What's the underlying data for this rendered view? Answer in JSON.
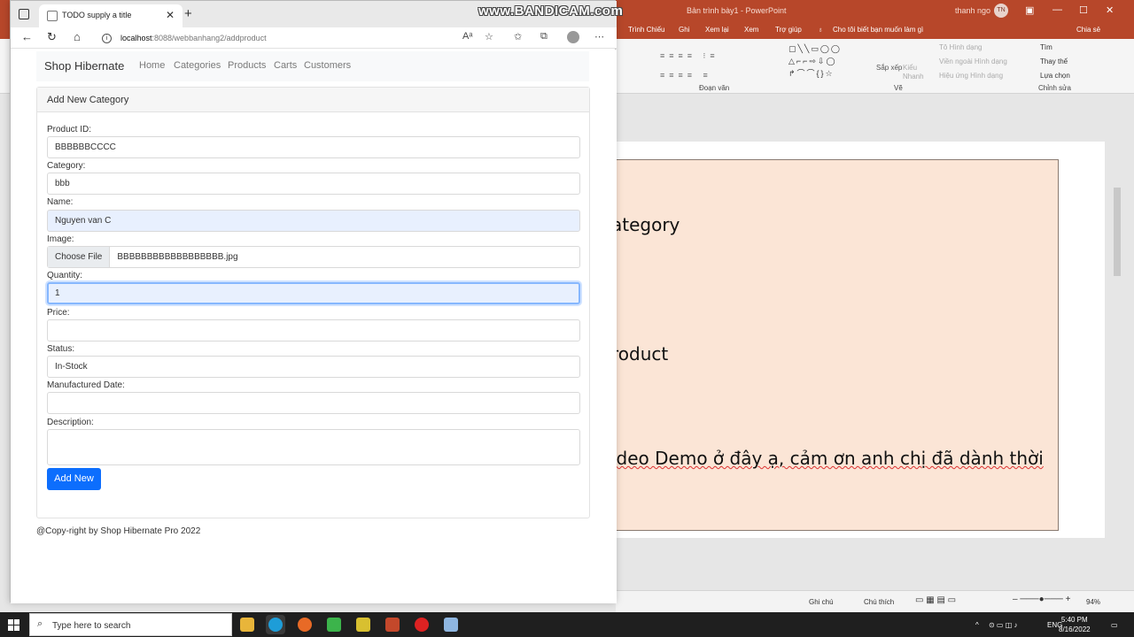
{
  "watermark": "www.BANDICAM.com",
  "powerpoint": {
    "doc_title": "Bản trình bày1 - PowerPoint",
    "user_name": "thanh ngo",
    "user_initials": "TN",
    "tabs": [
      "Trình Chiếu",
      "Ghi",
      "Xem lại",
      "Xem",
      "Trợ giúp"
    ],
    "tell_me": "Cho tôi biết bạn muốn làm gì",
    "share": "Chia sẻ",
    "ribbon": {
      "paragraph_group": "Đoạn văn",
      "drawing_group": "Vẽ",
      "editing_group": "Chỉnh sửa",
      "arrange": "Sắp xếp",
      "quick_styles": "Kiểu Nhanh",
      "shape_fill": "Tô Hình dạng",
      "shape_outline": "Viền ngoài Hình dạng",
      "shape_effects": "Hiệu ứng Hình dạng",
      "find": "Tìm",
      "replace": "Thay thế",
      "select": "Lựa chọn"
    },
    "slide_lines": [
      "ategory",
      "roduct",
      "ideo Demo ở đây ạ, cảm ơn anh chị đã dành thời"
    ],
    "status": {
      "notes": "Ghi chú",
      "comments": "Chú thích",
      "zoom": "94%"
    }
  },
  "browser": {
    "tab_title": "TODO supply a title",
    "url_host": "localhost",
    "url_path": ":8088/webbanhang2/addproduct"
  },
  "site": {
    "brand": "Shop Hibernate",
    "nav": [
      "Home",
      "Categories",
      "Products",
      "Carts",
      "Customers"
    ],
    "card_title": "Add New Category",
    "footer": "@Copy-right by Shop Hibernate Pro 2022"
  },
  "form": {
    "product_id": {
      "label": "Product ID:",
      "value": "BBBBBBCCCC"
    },
    "category": {
      "label": "Category:",
      "value": "bbb"
    },
    "name": {
      "label": "Name:",
      "value": "Nguyen van C"
    },
    "image": {
      "label": "Image:",
      "button": "Choose File",
      "file": "BBBBBBBBBBBBBBBBBB.jpg"
    },
    "quantity": {
      "label": "Quantity:",
      "value": "1"
    },
    "price": {
      "label": "Price:",
      "value": ""
    },
    "status": {
      "label": "Status:",
      "value": "In-Stock"
    },
    "manufactured_date": {
      "label": "Manufactured Date:",
      "value": ""
    },
    "description": {
      "label": "Description:",
      "value": ""
    },
    "submit": "Add New"
  },
  "taskbar": {
    "search_placeholder": "Type here to search",
    "lang": "ENG",
    "time": "5:40 PM",
    "date": "8/16/2022"
  },
  "colors": {
    "primary": "#0d6efd",
    "ppt_red": "#b7472a",
    "slide_fill": "#fbe5d6"
  }
}
